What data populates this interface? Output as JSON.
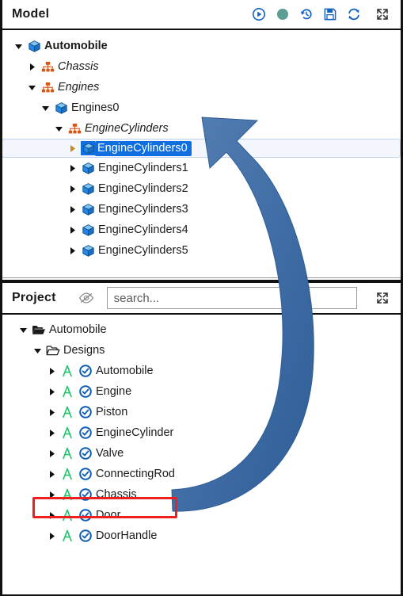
{
  "model_panel": {
    "title": "Model",
    "toolbar": [
      {
        "name": "run-icon",
        "label": "Run"
      },
      {
        "name": "status-dot-icon",
        "label": "Status",
        "color": "#5c9e93"
      },
      {
        "name": "history-revert-icon",
        "label": "Revert"
      },
      {
        "name": "save-icon",
        "label": "Save"
      },
      {
        "name": "refresh-icon",
        "label": "Refresh"
      },
      {
        "name": "expand-icon",
        "label": "Maximize"
      }
    ],
    "tree": [
      {
        "label": "Automobile",
        "indent": 0,
        "twisty": "down",
        "icon": "cube-icon",
        "style": "bold",
        "selected": false
      },
      {
        "label": "Chassis",
        "indent": 1,
        "twisty": "right",
        "icon": "hierarchy-icon",
        "style": "italic",
        "selected": false
      },
      {
        "label": "Engines",
        "indent": 1,
        "twisty": "down",
        "icon": "hierarchy-icon",
        "style": "italic",
        "selected": false
      },
      {
        "label": "Engines0",
        "indent": 2,
        "twisty": "down",
        "icon": "cube-icon",
        "style": "",
        "selected": false
      },
      {
        "label": "EngineCylinders",
        "indent": 3,
        "twisty": "down",
        "icon": "hierarchy-icon",
        "style": "italic",
        "selected": false
      },
      {
        "label": "EngineCylinders0",
        "indent": 4,
        "twisty": "right",
        "icon": "cube-icon",
        "style": "",
        "selected": true
      },
      {
        "label": "EngineCylinders1",
        "indent": 4,
        "twisty": "right",
        "icon": "cube-icon",
        "style": "",
        "selected": false
      },
      {
        "label": "EngineCylinders2",
        "indent": 4,
        "twisty": "right",
        "icon": "cube-icon",
        "style": "",
        "selected": false
      },
      {
        "label": "EngineCylinders3",
        "indent": 4,
        "twisty": "right",
        "icon": "cube-icon",
        "style": "",
        "selected": false
      },
      {
        "label": "EngineCylinders4",
        "indent": 4,
        "twisty": "right",
        "icon": "cube-icon",
        "style": "",
        "selected": false
      },
      {
        "label": "EngineCylinders5",
        "indent": 4,
        "twisty": "right",
        "icon": "cube-icon",
        "style": "",
        "selected": false
      }
    ]
  },
  "project_panel": {
    "title": "Project",
    "visibility_icon": "eye-off-icon",
    "search": {
      "value": "",
      "placeholder": "search..."
    },
    "expand_icon": "expand-icon",
    "tree": [
      {
        "label": "Automobile",
        "indent": 0,
        "twisty": "down",
        "icon": "folder-filled-icon",
        "check": false,
        "highlight": false
      },
      {
        "label": "Designs",
        "indent": 1,
        "twisty": "down",
        "icon": "folder-outline-icon",
        "check": false,
        "highlight": false
      },
      {
        "label": "Automobile",
        "indent": 2,
        "twisty": "right",
        "icon": "letter-a-icon",
        "check": true,
        "highlight": false
      },
      {
        "label": "Engine",
        "indent": 2,
        "twisty": "right",
        "icon": "letter-a-icon",
        "check": true,
        "highlight": false
      },
      {
        "label": "Piston",
        "indent": 2,
        "twisty": "right",
        "icon": "letter-a-icon",
        "check": true,
        "highlight": false
      },
      {
        "label": "EngineCylinder",
        "indent": 2,
        "twisty": "right",
        "icon": "letter-a-icon",
        "check": true,
        "highlight": false
      },
      {
        "label": "Valve",
        "indent": 2,
        "twisty": "right",
        "icon": "letter-a-icon",
        "check": true,
        "highlight": false
      },
      {
        "label": "ConnectingRod",
        "indent": 2,
        "twisty": "right",
        "icon": "letter-a-icon",
        "check": true,
        "highlight": true
      },
      {
        "label": "Chassis",
        "indent": 2,
        "twisty": "right",
        "icon": "letter-a-icon",
        "check": true,
        "highlight": false
      },
      {
        "label": "Door",
        "indent": 2,
        "twisty": "right",
        "icon": "letter-a-icon",
        "check": true,
        "highlight": false
      },
      {
        "label": "DoorHandle",
        "indent": 2,
        "twisty": "right",
        "icon": "letter-a-icon",
        "check": true,
        "highlight": false
      }
    ]
  },
  "annotations": {
    "arrow": {
      "name": "callout-arrow",
      "color": "#3e6fa8",
      "from_label": "ConnectingRod",
      "to_label": "EngineCylinders0"
    },
    "highlight_box": {
      "name": "callout-red-box",
      "color": "#ef1f1f",
      "target_label": "ConnectingRod"
    }
  },
  "colors": {
    "selection_blue": "#0f6fe0",
    "cube_blue": "#2486e0",
    "hierarchy_orange": "#d4571a",
    "letter_a_green": "#1fc46a",
    "check_blue": "#0b5cb5",
    "status_teal": "#5c9e93",
    "annotation_red": "#ef1f1f",
    "arrow_blue": "#3e6fa8"
  }
}
